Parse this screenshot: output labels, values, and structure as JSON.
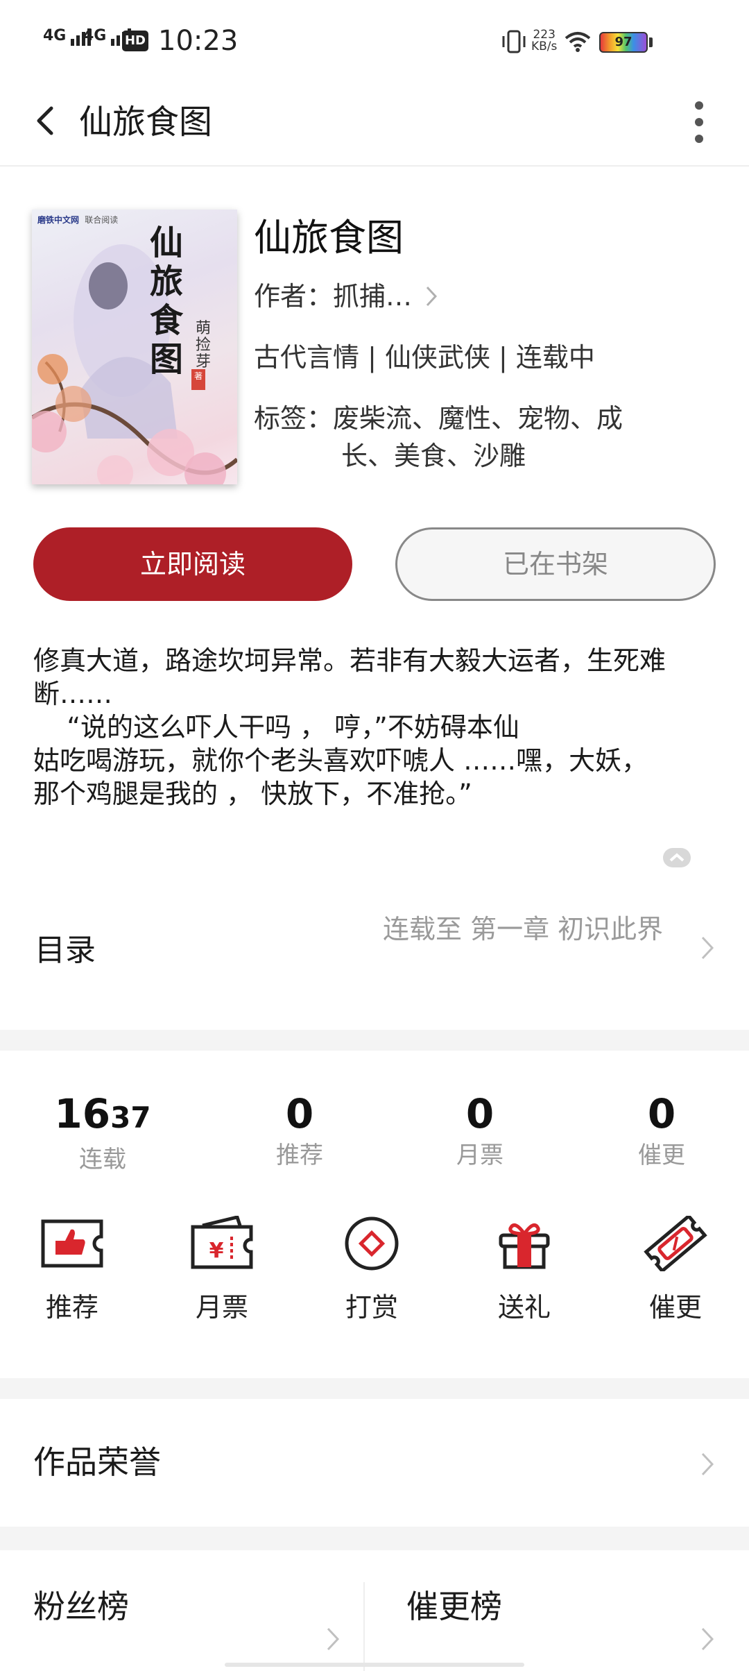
{
  "status_bar": {
    "signal1": "4G",
    "signal2": "4G",
    "hd": "HD",
    "time": "10:23",
    "net_speed_value": "223",
    "net_speed_unit": "KB/s",
    "battery": "97"
  },
  "header": {
    "title": "仙旅食图"
  },
  "book": {
    "cover_publisher": "磨铁中文网",
    "cover_tag": "联合阅读",
    "cover_title": "仙旅食图",
    "cover_author": "萌捡芽",
    "cover_badge": "著",
    "title": "仙旅食图",
    "author_label": "作者：",
    "author": "抓捕…",
    "category": "古代言情 | 仙侠武侠 | 连载中",
    "tags_label": "标签：",
    "tags_line1": "废柴流、魔性、宠物、成",
    "tags_line2": "长、美食、沙雕"
  },
  "buttons": {
    "read": "立即阅读",
    "shelf": "已在书架"
  },
  "description": "修真大道，路途坎坷异常。若非有大毅大运者，生死难断……\n    “说的这么吓人干吗 ， 哼，”不妨碍本仙\n姑吃喝游玩，就你个老头喜欢吓唬人 ……嘿，大妖，\n那个鸡腿是我的 ， 快放下，不准抢。”",
  "toc": {
    "label": "目录",
    "latest": "连载至 第一章 初识此界"
  },
  "stats": [
    {
      "num_big": "16",
      "num_small": "37",
      "label": "连载"
    },
    {
      "num": "0",
      "label": "推荐"
    },
    {
      "num": "0",
      "label": "月票"
    },
    {
      "num": "0",
      "label": "催更"
    }
  ],
  "actions": [
    {
      "label": "推荐",
      "icon": "thumbs-up-ticket-icon"
    },
    {
      "label": "月票",
      "icon": "yuan-ticket-icon"
    },
    {
      "label": "打赏",
      "icon": "diamond-coin-icon"
    },
    {
      "label": "送礼",
      "icon": "gift-icon"
    },
    {
      "label": "催更",
      "icon": "tilted-ticket-icon"
    }
  ],
  "honors": {
    "label": "作品荣誉"
  },
  "rankings": {
    "fans": "粉丝榜",
    "urge": "催更榜"
  },
  "colors": {
    "accent": "#ae1f27",
    "icon_red": "#d9262d",
    "text_gray": "#999999"
  }
}
